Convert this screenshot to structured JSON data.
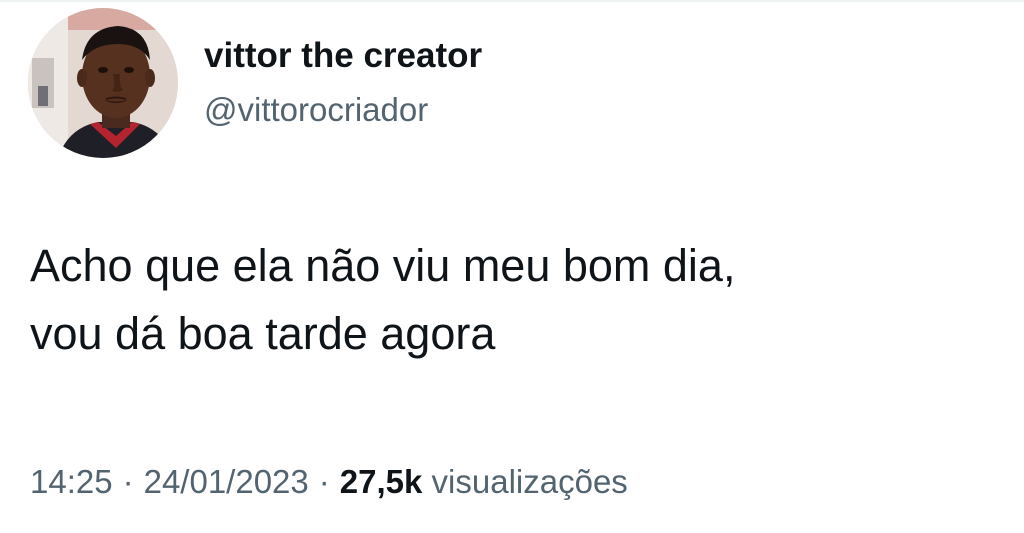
{
  "author": {
    "display_name": "vittor the creator",
    "handle": "@vittorocriador"
  },
  "tweet": {
    "lines": [
      "Acho que ela não viu meu bom dia,",
      "vou dá boa tarde agora"
    ]
  },
  "meta": {
    "time": "14:25",
    "separator": "·",
    "date": "24/01/2023",
    "views_count": "27,5k",
    "views_label": "visualizações"
  },
  "colors": {
    "text_primary": "#0f1419",
    "text_secondary": "#536471",
    "background": "#ffffff"
  }
}
